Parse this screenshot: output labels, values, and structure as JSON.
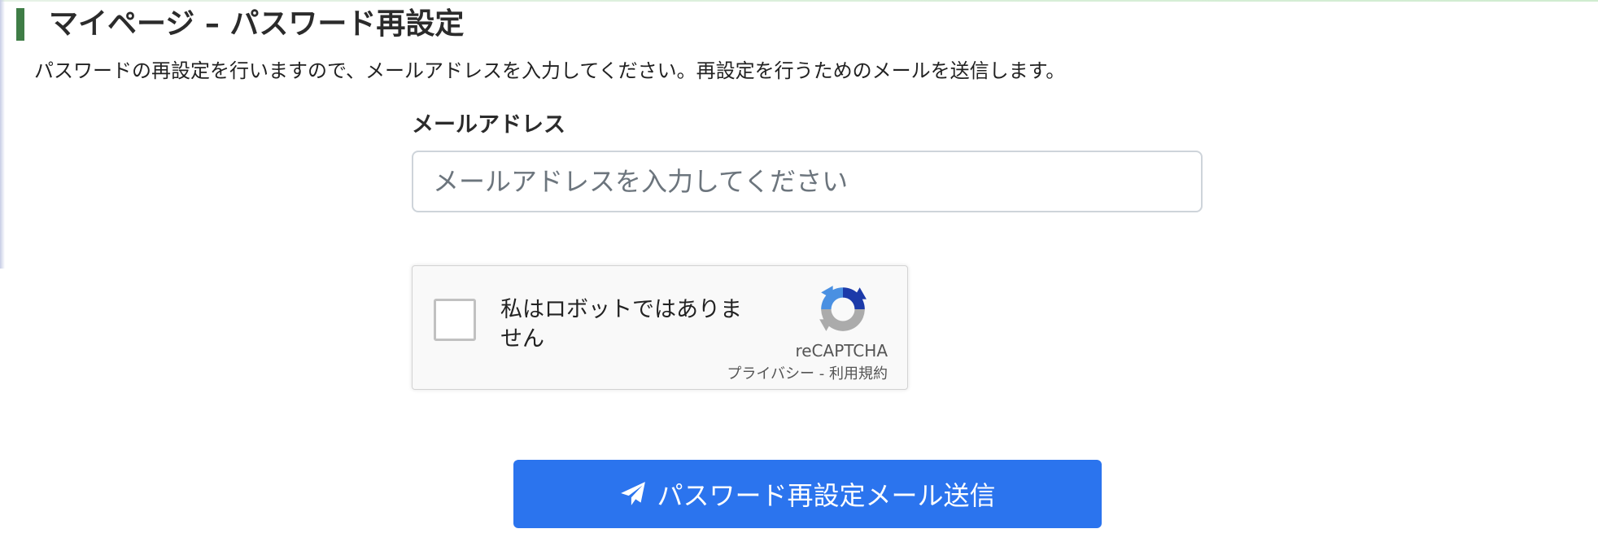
{
  "header": {
    "title": "マイページ – パスワード再設定",
    "accent_color": "#3f7d46"
  },
  "description": "パスワードの再設定を行いますので、メールアドレスを入力してください。再設定を行うためのメールを送信します。",
  "form": {
    "email_label": "メールアドレス",
    "email_value": "",
    "email_placeholder": "メールアドレスを入力してください"
  },
  "recaptcha": {
    "label": "私はロボットではありません",
    "brand": "reCAPTCHA",
    "privacy_link": "プライバシー",
    "separator": " - ",
    "terms_link": "利用規約",
    "checked": false,
    "logo_icon": "recaptcha-logo-icon"
  },
  "submit": {
    "label": "パスワード再設定メール送信",
    "icon": "paper-plane-icon",
    "color": "#2b74ee"
  }
}
